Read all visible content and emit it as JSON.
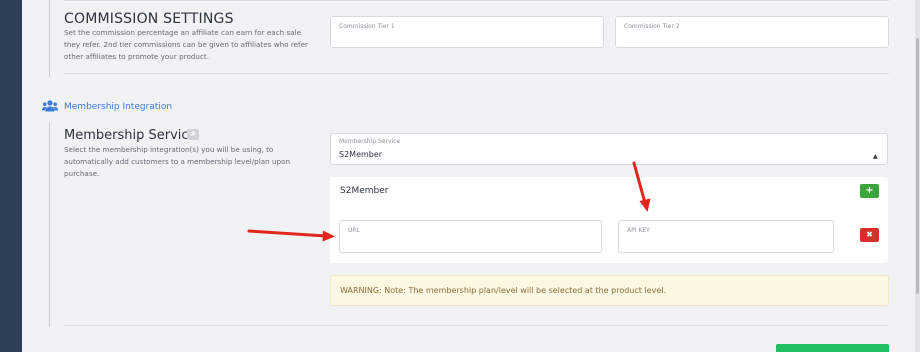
{
  "commission": {
    "title": "COMMISSION SETTINGS",
    "description": "Set the commission percentage an affiliate can earn for each sale they refer. 2nd tier commissions can be given to affiliates who refer other affiliates to promote your product.",
    "tier1_label": "Commission Tier 1",
    "tier2_label": "Commission Tier 2"
  },
  "membership_section": {
    "title": "Membership Integration",
    "icon": "users-icon"
  },
  "membership_service": {
    "title": "Membership Service",
    "help_badge": "#",
    "description": "Select the membership integration(s) you will be using, to automatically add customers to a membership level/plan upon purchase.",
    "select_label": "Membership Service",
    "select_value": "S2Member",
    "caret": "▲"
  },
  "integration_card": {
    "title": "S2Member",
    "add_button": "+",
    "url_label": "URL",
    "api_key_label": "API KEY",
    "delete_button": "✖"
  },
  "warning": {
    "text": "WARNING: Note: The membership plan/level will be selected at the product level."
  },
  "colors": {
    "sidebar": "#2e3e56",
    "accent": "#3a7bd5",
    "add_green": "#3aa63a",
    "delete_red": "#d6302b",
    "arrow_red": "#e1261c",
    "warning_bg": "#fcf8e3"
  }
}
